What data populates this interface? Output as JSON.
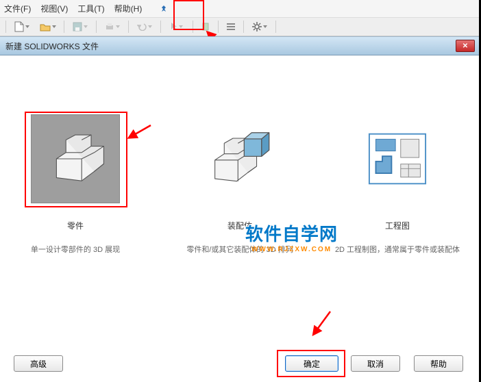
{
  "menu": {
    "file": "文件(F)",
    "view": "视图(V)",
    "tools": "工具(T)",
    "help": "帮助(H)"
  },
  "dialog": {
    "title": "新建 SOLIDWORKS 文件"
  },
  "options": {
    "part": {
      "title": "零件",
      "desc": "单一设计零部件的 3D 展现"
    },
    "assembly": {
      "title": "装配体",
      "desc": "零件和/或其它装配体的 3D 排列"
    },
    "drawing": {
      "title": "工程图",
      "desc": "2D 工程制图，通常属于零件或装配体"
    }
  },
  "buttons": {
    "advanced": "高级",
    "ok": "确定",
    "cancel": "取消",
    "help": "帮助"
  },
  "watermark": {
    "cn": "软件自学网",
    "en": "WWW.RJZXW.COM"
  }
}
